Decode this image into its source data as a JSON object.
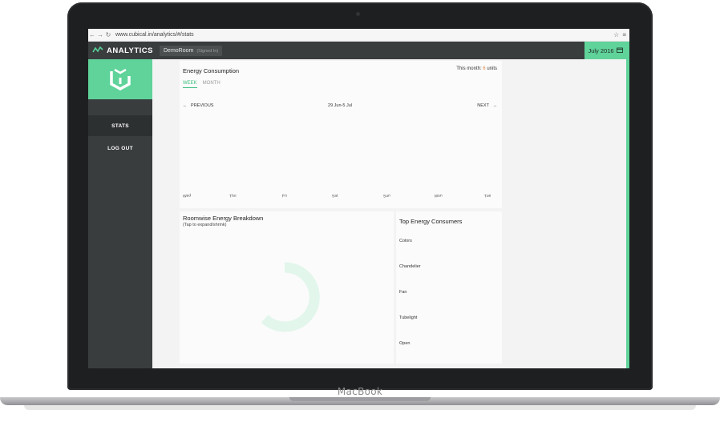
{
  "device": {
    "label": "MacBook"
  },
  "browser": {
    "url": "www.cubical.in/analytics/#/stats",
    "back_icon": "arrow-left-icon",
    "forward_icon": "arrow-right-icon",
    "reload_icon": "reload-icon"
  },
  "topbar": {
    "title": "ANALYTICS",
    "room": "DemoRoom",
    "room_status": "(Signed In)",
    "date": "July 2016"
  },
  "sidebar": {
    "items": [
      {
        "label": "STATS",
        "active": true
      },
      {
        "label": "LOG OUT",
        "active": false
      }
    ]
  },
  "energy": {
    "title": "Energy Consumption",
    "this_month_label": "This month:",
    "this_month_value": "6",
    "this_month_unit": "units",
    "tabs": [
      {
        "label": "WEEK",
        "active": true
      },
      {
        "label": "MONTH",
        "active": false
      }
    ],
    "prev": "PREVIOUS",
    "range": "29 Jun-5 Jul",
    "next": "NEXT",
    "days": [
      "Wed",
      "Thu",
      "Fri",
      "Sat",
      "Sun",
      "Mon",
      "Tue"
    ]
  },
  "roomwise": {
    "title": "Roomwise Energy Breakdown",
    "subtitle": "(Tap to expand/shrink)"
  },
  "top_consumers": {
    "title": "Top Energy Consumers",
    "items": [
      "Colors",
      "Chandelier",
      "Fan",
      "Tubelight",
      "Open"
    ]
  },
  "colors": {
    "accent": "#5fd39a",
    "dark": "#3a3d3e",
    "highlight": "#e0843d"
  }
}
